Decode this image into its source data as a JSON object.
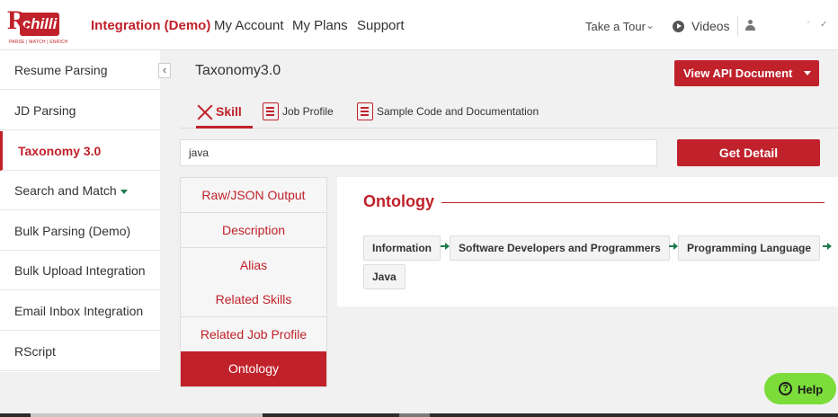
{
  "brand": {
    "logo_letter": "R",
    "logo_text": "chilli",
    "tagline": "PARSE | MATCH | ENRICH",
    "accent": "#c0212a",
    "success": "#1e7b4c",
    "help_green": "#7cdc3a"
  },
  "header": {
    "nav": [
      "Integration (Demo)",
      "My Account",
      "My Plans",
      "Support"
    ],
    "tour": "Take a Tour",
    "videos": "Videos"
  },
  "sidebar": {
    "items": [
      {
        "label": "Resume Parsing"
      },
      {
        "label": "JD Parsing"
      },
      {
        "label": "Taxonomy 3.0",
        "active": true
      },
      {
        "label": "Search and Match",
        "has_dropdown": true
      },
      {
        "label": "Bulk Parsing (Demo)"
      },
      {
        "label": "Bulk Upload Integration"
      },
      {
        "label": "Email Inbox Integration"
      },
      {
        "label": "RScript"
      }
    ]
  },
  "main": {
    "title": "Taxonomy3.0",
    "api_button": "View API Document",
    "tabs": [
      "Skill",
      "Job Profile",
      "Sample Code and Documentation"
    ],
    "search": {
      "value": "java"
    },
    "get_button": "Get Detail",
    "sub_nav": [
      "Raw/JSON Output",
      "Description",
      "Alias",
      "Related Skills",
      "Related Job Profile",
      "Ontology"
    ],
    "active_sub": "Ontology"
  },
  "ontology": {
    "title": "Ontology",
    "path": [
      "Information",
      "Software Developers and Programmers",
      "Programming Language",
      "Java"
    ]
  },
  "help": {
    "label": "Help",
    "icon": "question-circle-icon"
  }
}
